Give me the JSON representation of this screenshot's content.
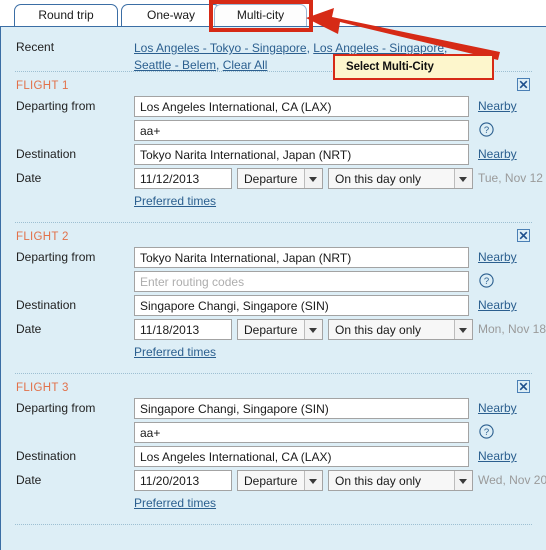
{
  "tabs": [
    {
      "id": "round-trip",
      "label": "Round trip",
      "selected": false
    },
    {
      "id": "one-way",
      "label": "One-way",
      "selected": false
    },
    {
      "id": "multi-city",
      "label": "Multi-city",
      "selected": true
    }
  ],
  "annotation": {
    "callout_text": "Select Multi-City",
    "highlight_color": "#d62a16",
    "callout_background": "#fdf6cc",
    "target_tab": "Multi-city"
  },
  "recent": {
    "label": "Recent",
    "links": [
      "Los Angeles - Tokyo - Singapore",
      "Los Angeles - Singapore",
      "Seattle - Belem",
      "Clear All"
    ],
    "separator": ", "
  },
  "labels": {
    "departing_from": "Departing from",
    "destination": "Destination",
    "date": "Date",
    "nearby": "Nearby",
    "preferred_times": "Preferred times",
    "routing_placeholder": "Enter routing codes"
  },
  "icons": {
    "close": "close-icon",
    "help": "question-mark-icon",
    "dropdown": "chevron-down-icon"
  },
  "colors": {
    "panel_background": "#ddeef6",
    "flight_heading": "#e2714a",
    "link": "#2b5f8f",
    "panel_border": "#3b6ea5"
  },
  "flights": [
    {
      "heading": "FLIGHT 1",
      "departing_from": "Los Angeles International, CA (LAX)",
      "routing_codes": "aa+",
      "routing_codes_placeholder": "Enter routing codes",
      "destination": "Tokyo Narita International, Japan (NRT)",
      "date": "11/12/2013",
      "date_type": "Departure",
      "date_window": "On this day only",
      "day_note": "Tue, Nov 12"
    },
    {
      "heading": "FLIGHT 2",
      "departing_from": "Tokyo Narita International, Japan (NRT)",
      "routing_codes": "",
      "routing_codes_placeholder": "Enter routing codes",
      "destination": "Singapore Changi, Singapore (SIN)",
      "date": "11/18/2013",
      "date_type": "Departure",
      "date_window": "On this day only",
      "day_note": "Mon, Nov 18"
    },
    {
      "heading": "FLIGHT 3",
      "departing_from": "Singapore Changi, Singapore (SIN)",
      "routing_codes": "aa+",
      "routing_codes_placeholder": "Enter routing codes",
      "destination": "Los Angeles International, CA (LAX)",
      "date": "11/20/2013",
      "date_type": "Departure",
      "date_window": "On this day only",
      "day_note": "Wed, Nov 20"
    }
  ]
}
